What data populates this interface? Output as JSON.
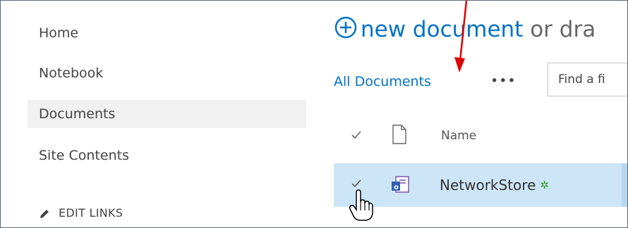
{
  "nav": {
    "items": [
      {
        "label": "Home"
      },
      {
        "label": "Notebook"
      },
      {
        "label": "Documents"
      },
      {
        "label": "Site Contents"
      }
    ],
    "edit_links": "EDIT LINKS"
  },
  "main": {
    "new_document": "new document",
    "or_drag": "or dra",
    "view_name": "All Documents",
    "more": "•••",
    "search_placeholder": "Find a fi",
    "columns": {
      "name": "Name"
    },
    "rows": [
      {
        "name": "NetworkStore",
        "new_marker": "✲"
      }
    ]
  },
  "colors": {
    "accent": "#0072c6",
    "selected_row": "#cde6f7",
    "annotation_arrow": "#e00000"
  },
  "icons": [
    "plus-circle-icon",
    "checkmark-icon",
    "file-icon",
    "onenote-icon",
    "pencil-icon",
    "hand-cursor-icon",
    "red-arrow-annotation"
  ]
}
